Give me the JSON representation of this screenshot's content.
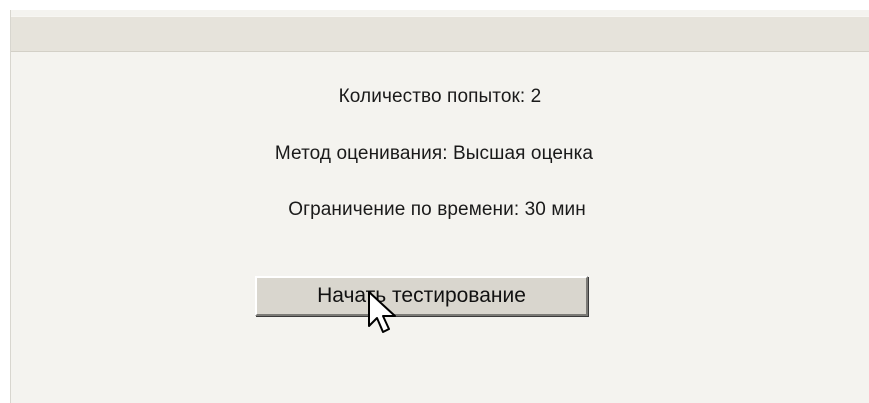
{
  "quiz_info": {
    "attempts": "Количество попыток: 2",
    "grading_method": "Метод оценивания: Высшая оценка",
    "time_limit": "Ограничение по времени: 30 мин"
  },
  "actions": {
    "start_label": "Начать тестирование"
  },
  "icons": {
    "cursor": "mouse-pointer-icon"
  }
}
